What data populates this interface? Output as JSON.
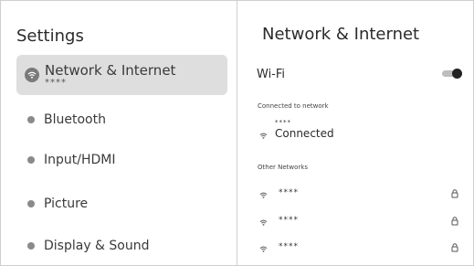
{
  "left_panel": {
    "title": "Settings",
    "items": [
      {
        "label": "Network & Internet",
        "sub": "****",
        "icon": "wifi-icon"
      },
      {
        "label": "Bluetooth",
        "icon": "bluetooth-icon"
      },
      {
        "label": "Input/HDMI",
        "icon": "input-icon"
      },
      {
        "label": "Picture",
        "icon": "picture-icon"
      },
      {
        "label": "Display & Sound",
        "icon": "display-sound-icon"
      }
    ]
  },
  "right_panel": {
    "title": "Network & Internet",
    "wifi": {
      "label": "Wi-Fi",
      "enabled": true
    },
    "connected_section": {
      "heading": "Connected to network",
      "network_name": "****",
      "status": "Connected"
    },
    "other_section": {
      "heading": "Other Networks",
      "networks": [
        {
          "name": "****",
          "locked": true
        },
        {
          "name": "****",
          "locked": true
        },
        {
          "name": "****",
          "locked": true
        }
      ]
    }
  },
  "colors": {
    "selected_bg": "#dedede",
    "divider": "#d0d0d0",
    "toggle_knob": "#222222",
    "toggle_track": "#bdbdbd"
  }
}
